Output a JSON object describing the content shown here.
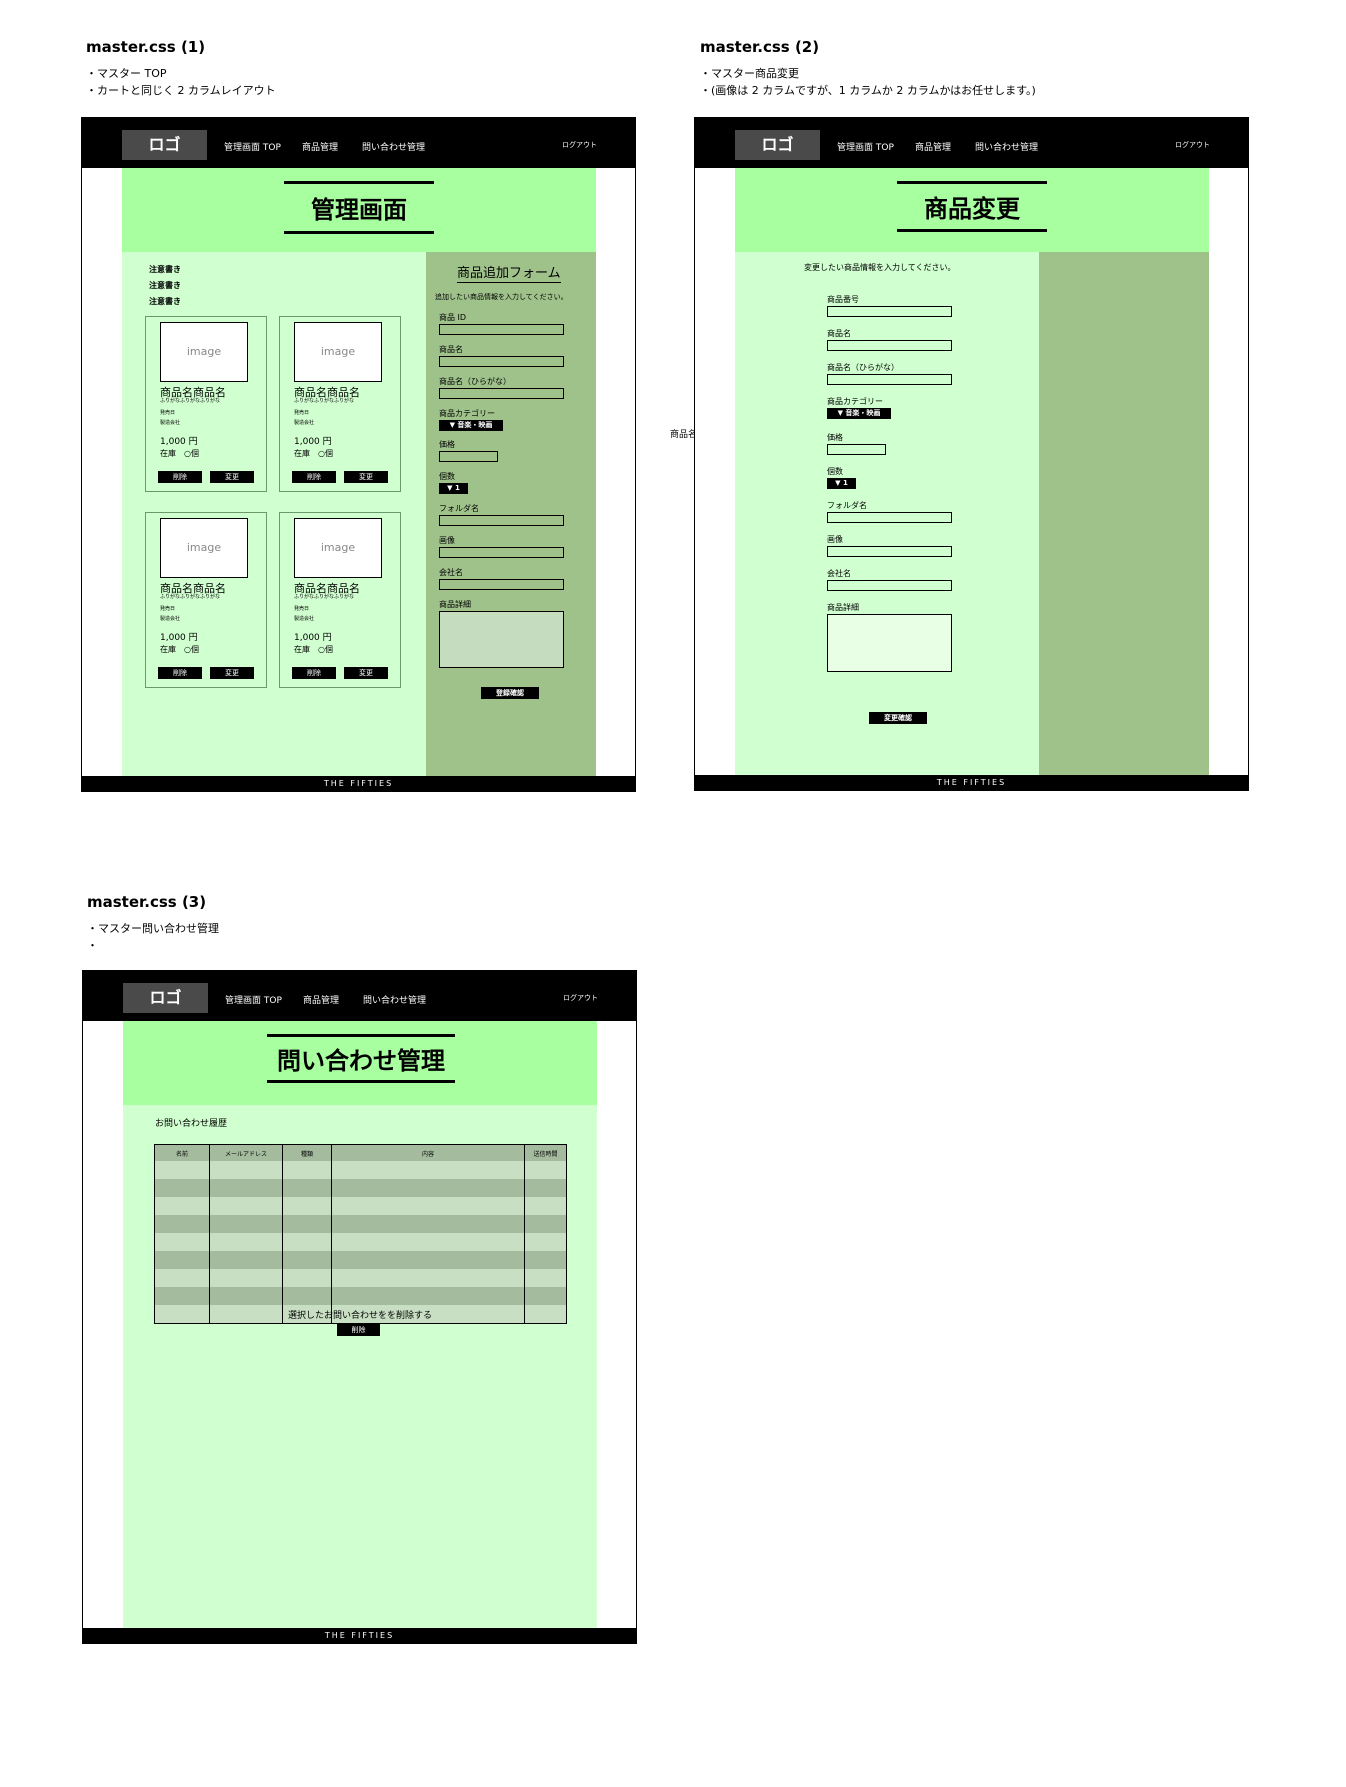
{
  "sections": {
    "s1": {
      "title": "master.css (1)",
      "notes": [
        "・マスター TOP",
        "・カートと同じく 2 カラムレイアウト"
      ]
    },
    "s2": {
      "title": "master.css (2)",
      "notes": [
        "・マスター商品変更",
        "・(画像は 2 カラムですが、1 カラムか 2 カラムかはお任せします。)"
      ]
    },
    "s3": {
      "title": "master.css (3)",
      "notes": [
        "・マスター問い合わせ管理",
        "・"
      ]
    }
  },
  "header": {
    "logo": "ロゴ",
    "nav": [
      "管理画面 TOP",
      "商品管理",
      "問い合わせ管理"
    ],
    "logout": "ログアウト"
  },
  "footer": "THE FIFTIES",
  "stray_label": "商品名",
  "mock1": {
    "page_title": "管理画面",
    "notes": [
      "注意書き",
      "注意書き",
      "注意書き"
    ],
    "card": {
      "image": "image",
      "name": "商品名商品名",
      "furigana": "ふりがなふりがなふりがな",
      "release": "発売日",
      "company": "製造会社",
      "price": "1,000 円",
      "stock": "在庫　○個",
      "delete": "削除",
      "edit": "変更"
    },
    "form": {
      "title": "商品追加フォーム",
      "instruction": "追加したい商品情報を入力してください。",
      "fields": [
        "商品 ID",
        "商品名",
        "商品名（ひらがな）",
        "商品カテゴリー",
        "価格",
        "個数",
        "フォルダ名",
        "画像",
        "会社名",
        "商品詳細"
      ],
      "category_value": "▼ 音楽・映画",
      "quantity_value": "▼ 1",
      "submit": "登録確認"
    }
  },
  "mock2": {
    "page_title": "商品変更",
    "instruction": "変更したい商品情報を入力してください。",
    "fields": [
      "商品番号",
      "商品名",
      "商品名（ひらがな）",
      "商品カテゴリー",
      "価格",
      "個数",
      "フォルダ名",
      "画像",
      "会社名",
      "商品詳細"
    ],
    "category_value": "▼ 音楽・映画",
    "quantity_value": "▼ 1",
    "submit": "変更確認"
  },
  "mock3": {
    "page_title": "問い合わせ管理",
    "history_title": "お問い合わせ履歴",
    "columns": [
      "名前",
      "メールアドレス",
      "種類",
      "内容",
      "送信時間"
    ],
    "delete_label": "選択したお問い合わせをを削除する",
    "delete_button": "削除"
  }
}
